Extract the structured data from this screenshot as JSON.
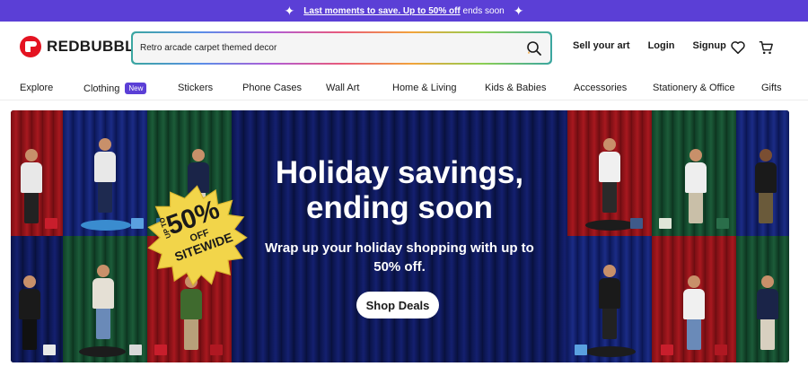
{
  "promo": {
    "link_text": "Last moments to save. Up to 50% off",
    "rest_text": "ends soon",
    "bg_color": "#5b3fd6"
  },
  "header": {
    "brand": "REDBUBBLE",
    "brand_color": "#e41321",
    "search_value": "Retro arcade carpet themed decor",
    "links": [
      "Sell your art",
      "Login",
      "Signup"
    ],
    "icons": [
      "heart-icon",
      "cart-icon"
    ]
  },
  "nav": {
    "items": [
      "Explore",
      "Clothing",
      "Stickers",
      "Phone Cases",
      "Wall Art",
      "Home & Living",
      "Kids & Babies",
      "Accessories",
      "Stationery & Office",
      "Gifts"
    ],
    "badge": "New"
  },
  "hero": {
    "headline": "Holiday savings, ending soon",
    "subtext": "Wrap up your holiday shopping with up to 50% off.",
    "button": "Shop Deals",
    "burst": {
      "up_to": "UP TO",
      "percent": "50%",
      "off": "OFF",
      "sitewide": "SITEWIDE"
    }
  }
}
